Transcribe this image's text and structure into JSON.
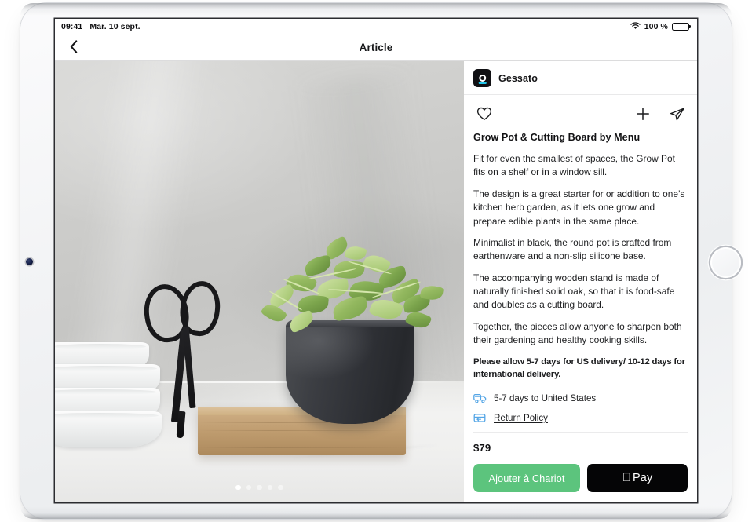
{
  "status_bar": {
    "time": "09:41",
    "date": "Mar. 10 sept.",
    "wifi_icon": "wifi-icon",
    "battery_percent": "100 %",
    "battery_icon": "battery-full-icon"
  },
  "nav_bar": {
    "back_icon": "chevron-left-icon",
    "title": "Article"
  },
  "gallery": {
    "alt": "Black earthenware grow pot with microgreens on an oak cutting board, stacked white bowls and black scissors",
    "page_count": 5,
    "active_page": 1
  },
  "details": {
    "brand": {
      "name": "Gessato",
      "logo_icon": "gessato-logo-icon",
      "logo_accent_color": "#21c4e8"
    },
    "actions": {
      "favorite_icon": "heart-icon",
      "add_icon": "plus-icon",
      "share_icon": "send-icon"
    },
    "product_title": "Grow Pot & Cutting Board by Menu",
    "paragraphs": [
      "Fit for even the smallest of spaces, the Grow Pot fits on a shelf or in a window sill.",
      "The design is a great starter for or addition to one’s kitchen herb garden, as it lets one grow and prepare edible plants in the same place.",
      "Minimalist in black, the round pot is crafted from earthenware and a non-slip silicone base.",
      "The accompanying wooden stand is made of naturally finished solid oak, so that it is food-safe and doubles as a cutting board.",
      "Together, the pieces allow anyone to sharpen both their gardening and healthy cooking skills."
    ],
    "shipping_note": "Please allow 5-7 days for US delivery/ 10-12 days for international delivery.",
    "shipping_row": {
      "icon": "delivery-truck-icon",
      "icon_color": "#55a6e6",
      "text_prefix": "5-7 days to ",
      "destination": "United States"
    },
    "returns_row": {
      "icon": "return-box-icon",
      "icon_color": "#55a6e6",
      "label": "Return Policy"
    },
    "price": "$79",
    "cart_button": {
      "label": "Ajouter à Chariot",
      "color": "#5cc47d"
    },
    "apple_pay_button": {
      "apple_glyph": "apple-logo-icon",
      "label": "Pay",
      "color": "#050506"
    }
  },
  "device": {
    "front_camera_icon": "front-camera-icon",
    "home_button_icon": "home-button-icon"
  }
}
